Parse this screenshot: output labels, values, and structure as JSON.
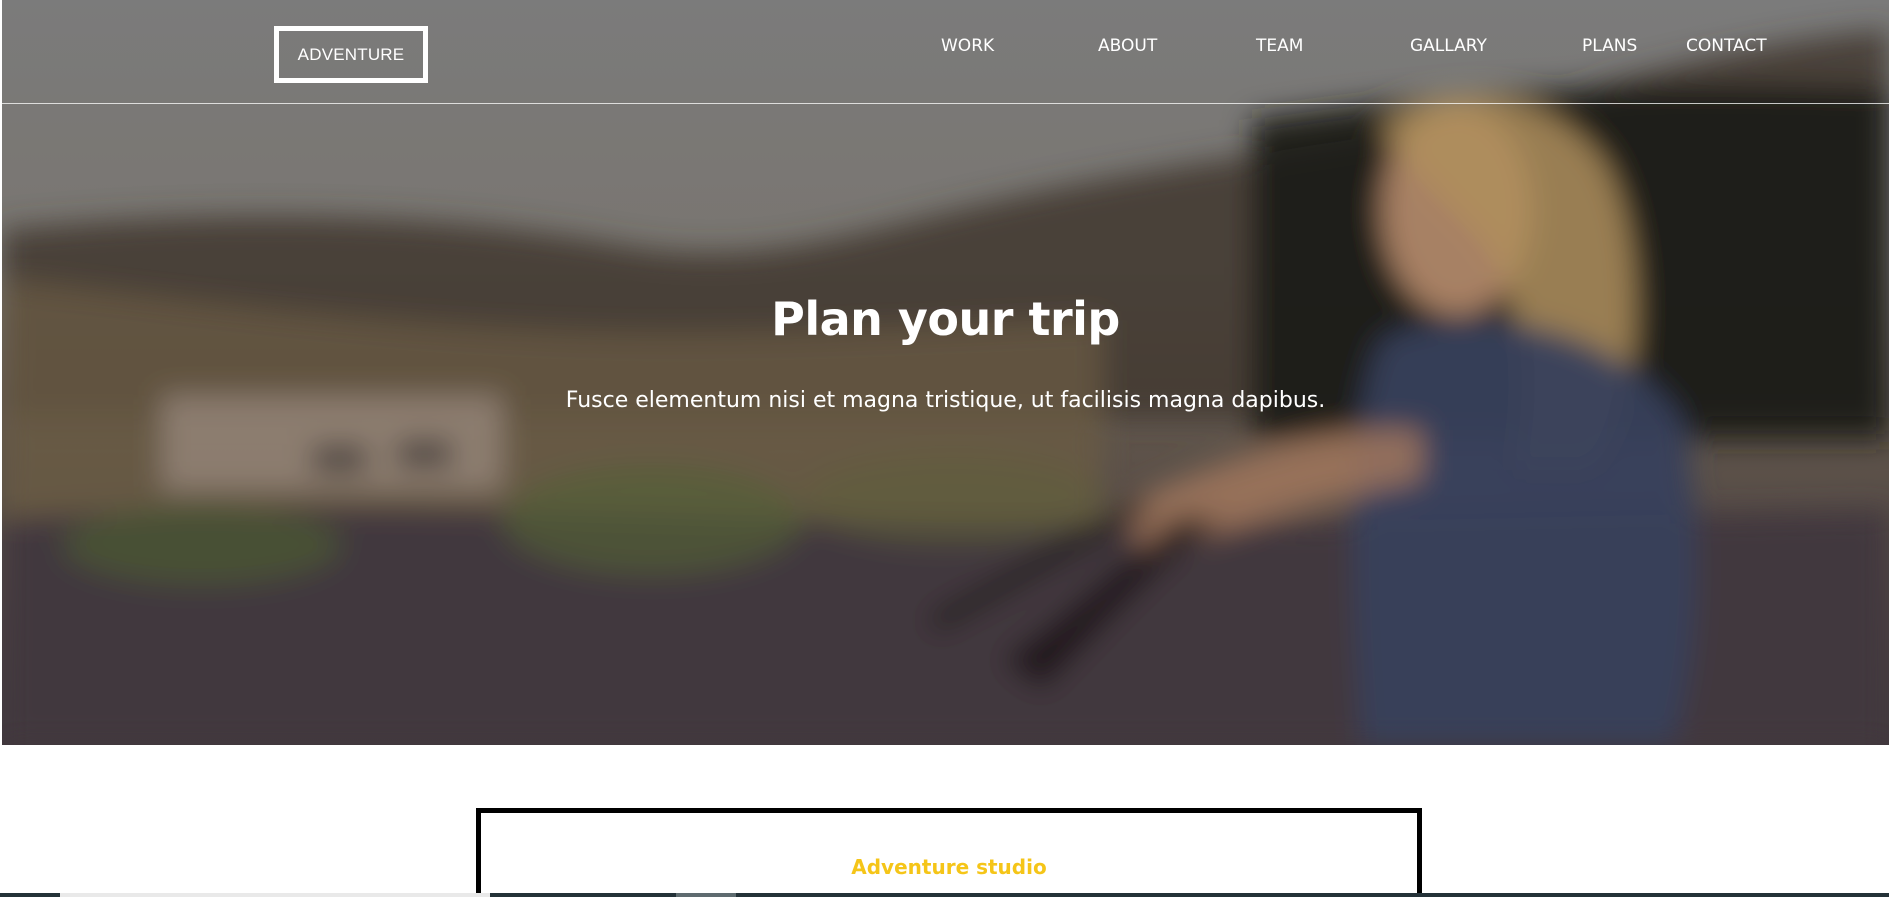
{
  "header": {
    "brand": "ADVENTURE",
    "nav": [
      "WORK",
      "ABOUT",
      "TEAM",
      "GALLARY",
      "PLANS",
      "CONTACT"
    ]
  },
  "hero": {
    "title": "Plan your trip",
    "subtitle": "Fusce elementum nisi et magna tristique, ut facilisis magna dapibus."
  },
  "studio": {
    "title": "Adventure studio"
  },
  "colors": {
    "accent": "#f5c518",
    "text_on_hero": "#ffffff",
    "border": "#000000"
  }
}
